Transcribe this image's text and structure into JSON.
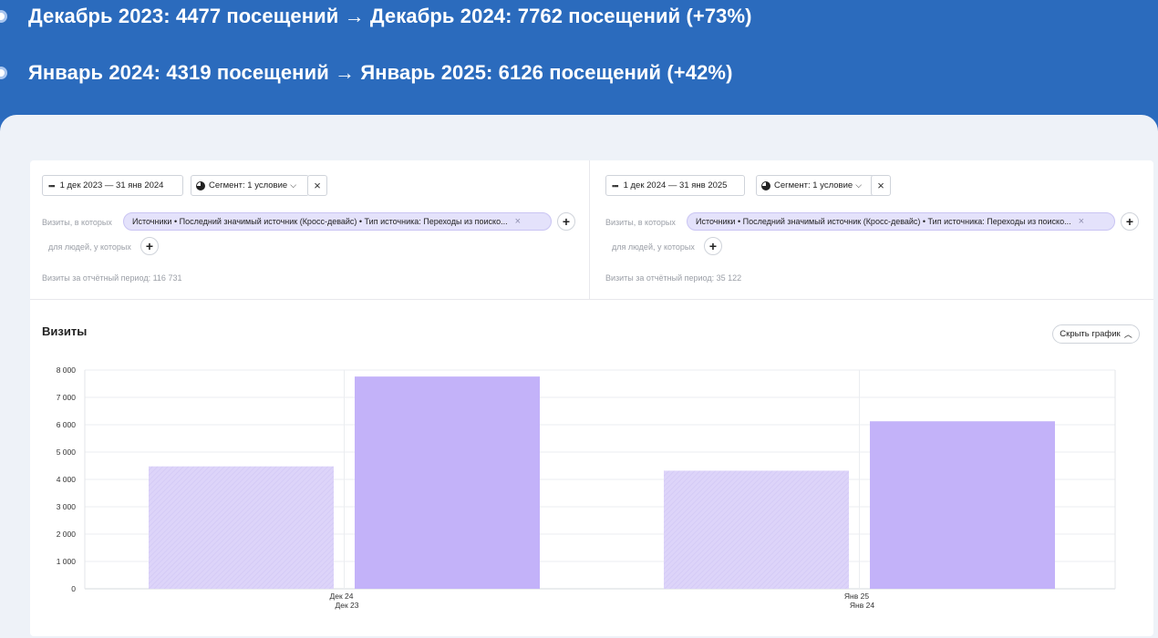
{
  "bullets": [
    "Декабрь 2023: 4477 посещений → Декабрь 2024: 7762 посещений (+73%)",
    "Январь 2024: 4319 посещений → Январь 2025: 6126 посещений (+42%)"
  ],
  "left": {
    "date_range": "1 дек 2023 — 31 янв 2024",
    "segment": "Сегмент: 1 условие",
    "visits_label": "Визиты, в которых",
    "filter_chip": "Источники • Последний значимый источник (Кросс-девайс) • Тип источника: Переходы из поиско...",
    "people_label": "для людей, у которых",
    "total": "Визиты за отчётный период: 116 731"
  },
  "right": {
    "date_range": "1 дек 2024 — 31 янв 2025",
    "segment": "Сегмент: 1 условие",
    "visits_label": "Визиты, в которых",
    "filter_chip": "Источники • Последний значимый источник (Кросс-девайс) • Тип источника: Переходы из поиско...",
    "people_label": "для людей, у которых",
    "total": "Визиты за отчётный период: 35 122"
  },
  "chart_title": "Визиты",
  "hide_chart_label": "Скрыть график",
  "colors": {
    "bar_previous": "#ddd4f9",
    "bar_current": "#c3b2f9",
    "banner": "#2b6bbd"
  },
  "chart_data": {
    "type": "bar",
    "categories": [
      {
        "top": "Дек 24",
        "bottom": "Дек 23"
      },
      {
        "top": "Янв 25",
        "bottom": "Янв 24"
      }
    ],
    "series": [
      {
        "values": [
          4477,
          4319
        ]
      },
      {
        "values": [
          7762,
          6126
        ]
      }
    ],
    "ylim": [
      0,
      8000
    ],
    "yticks": [
      "0",
      "1 000",
      "2 000",
      "3 000",
      "4 000",
      "5 000",
      "6 000",
      "7 000",
      "8 000"
    ],
    "grid": true
  }
}
